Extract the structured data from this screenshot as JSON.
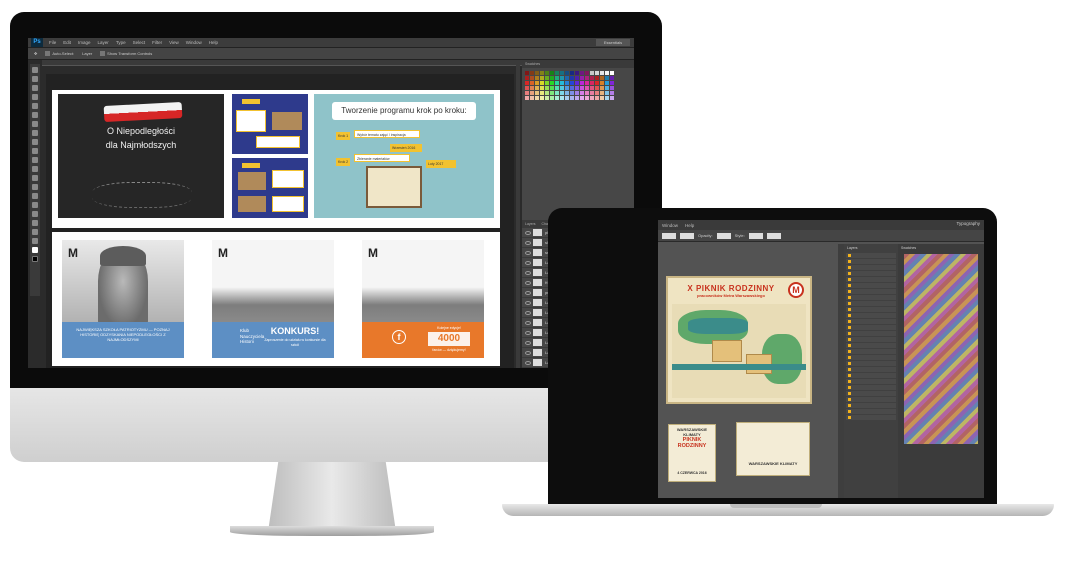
{
  "photoshop": {
    "logo": "Ps",
    "menu": [
      "File",
      "Edit",
      "Image",
      "Layer",
      "Type",
      "Select",
      "Filter",
      "View",
      "Window",
      "Help"
    ],
    "workspace": "Essentials",
    "options": {
      "auto_select": "Auto-Select:",
      "auto_select_target": "Layer",
      "transform_controls": "Show Transform Controls"
    },
    "panels": {
      "swatches_tab": "Swatches",
      "layers_tabs": [
        "Layers",
        "Channels",
        "Paths"
      ]
    },
    "layers": [
      "plansze slajdow z cz 1",
      "slide_1",
      "snailsms_4",
      "Layer 6",
      "Layer 5",
      "Kwadra",
      "prjaghlt 1",
      "Layer 1",
      "Layer 7",
      "Layer 4",
      "Layer 8",
      "Layer 3",
      "Layer 2",
      "Layer 1"
    ],
    "slides": {
      "chalk_title_line1": "O Niepodległości",
      "chalk_title_line2": "dla Najmłodszych",
      "mini_badge": "ETAP1 zeszlam",
      "steps_title": "Tworzenie programu krok po kroku:",
      "step1_label": "Krok 1",
      "step1_text": "Wybór tematu zajęć / inspiracja",
      "step1_date": "Wrzesień 2016",
      "step2_label": "Krok 2",
      "step2_text": "Zbieranie materiałów",
      "step2_date": "Luty 2017"
    },
    "cards": {
      "card1_text": "NAJWIĘKSZA SZKOŁA PATRIOTYZMU — POZNAJ HISTORIĘ ODZYSKANIA NIEPODLEGŁOŚCI Z NAJMŁODSZYMI",
      "card2_klub": "Klub Nauczyciela Historii",
      "card2_title": "KONKURS!",
      "card2_sub": "Zaproszenie do udziału w konkursie dla szkół",
      "card3_top": "Kolejne edycje!",
      "card3_count": "4000",
      "card3_bottom": "fanów — dziękujemy!"
    }
  },
  "illustrator": {
    "menu": [
      "Window",
      "Help"
    ],
    "workspace": "Typography",
    "options": {
      "opacity_label": "Opacity:",
      "style_label": "Style:"
    },
    "poster_title": "X PIKNIK RODZINNY",
    "poster_subtitle": "pracowników Metra Warszawskiego",
    "metro_logo": "M",
    "flyer1_title": "WARSZAWSKIE KLIMATY",
    "flyer1_sub": "PIKNIK RODZINNY",
    "flyer1_date": "4 CZERWCA 2016",
    "flyer2_title": "WARSZAWSKIE KLIMATY",
    "layers_panel_title": "Layers",
    "color_panel_title": "Swatches"
  },
  "colors": {
    "ps_bg": "#2b2b2b",
    "slide_blue": "#2e3a8c",
    "accent_yellow": "#f2c230",
    "card_blue": "#5d8fc4",
    "card_orange": "#e8782a",
    "poster_red": "#c8321e"
  }
}
